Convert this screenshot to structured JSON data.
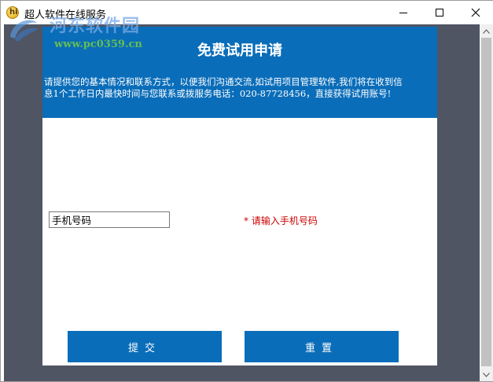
{
  "window": {
    "title": "超人软件在线服务"
  },
  "watermark": {
    "site_name": "河东软件园",
    "url": "www.pc0359.cn"
  },
  "form": {
    "title": "免费试用申请",
    "description": "请提供您的基本情况和联系方式，以便我们沟通交流,如试用项目管理软件,我们将在收到信息1个工作日内最快时间与您联系或拨服务电话：020-87728456，直接获得试用账号!",
    "phone": {
      "value": "手机号码",
      "hint": "* 请输入手机号码"
    },
    "buttons": {
      "submit": "提交",
      "reset": "重置"
    }
  },
  "colors": {
    "accent": "#0a6db9",
    "hint": "#cc0000",
    "backdrop": "#4f5563"
  },
  "icons": {
    "app": "app-icon",
    "minimize": "minimize-icon",
    "maximize": "maximize-icon",
    "close": "close-icon",
    "scroll_up": "chevron-up-icon",
    "scroll_down": "chevron-down-icon"
  }
}
